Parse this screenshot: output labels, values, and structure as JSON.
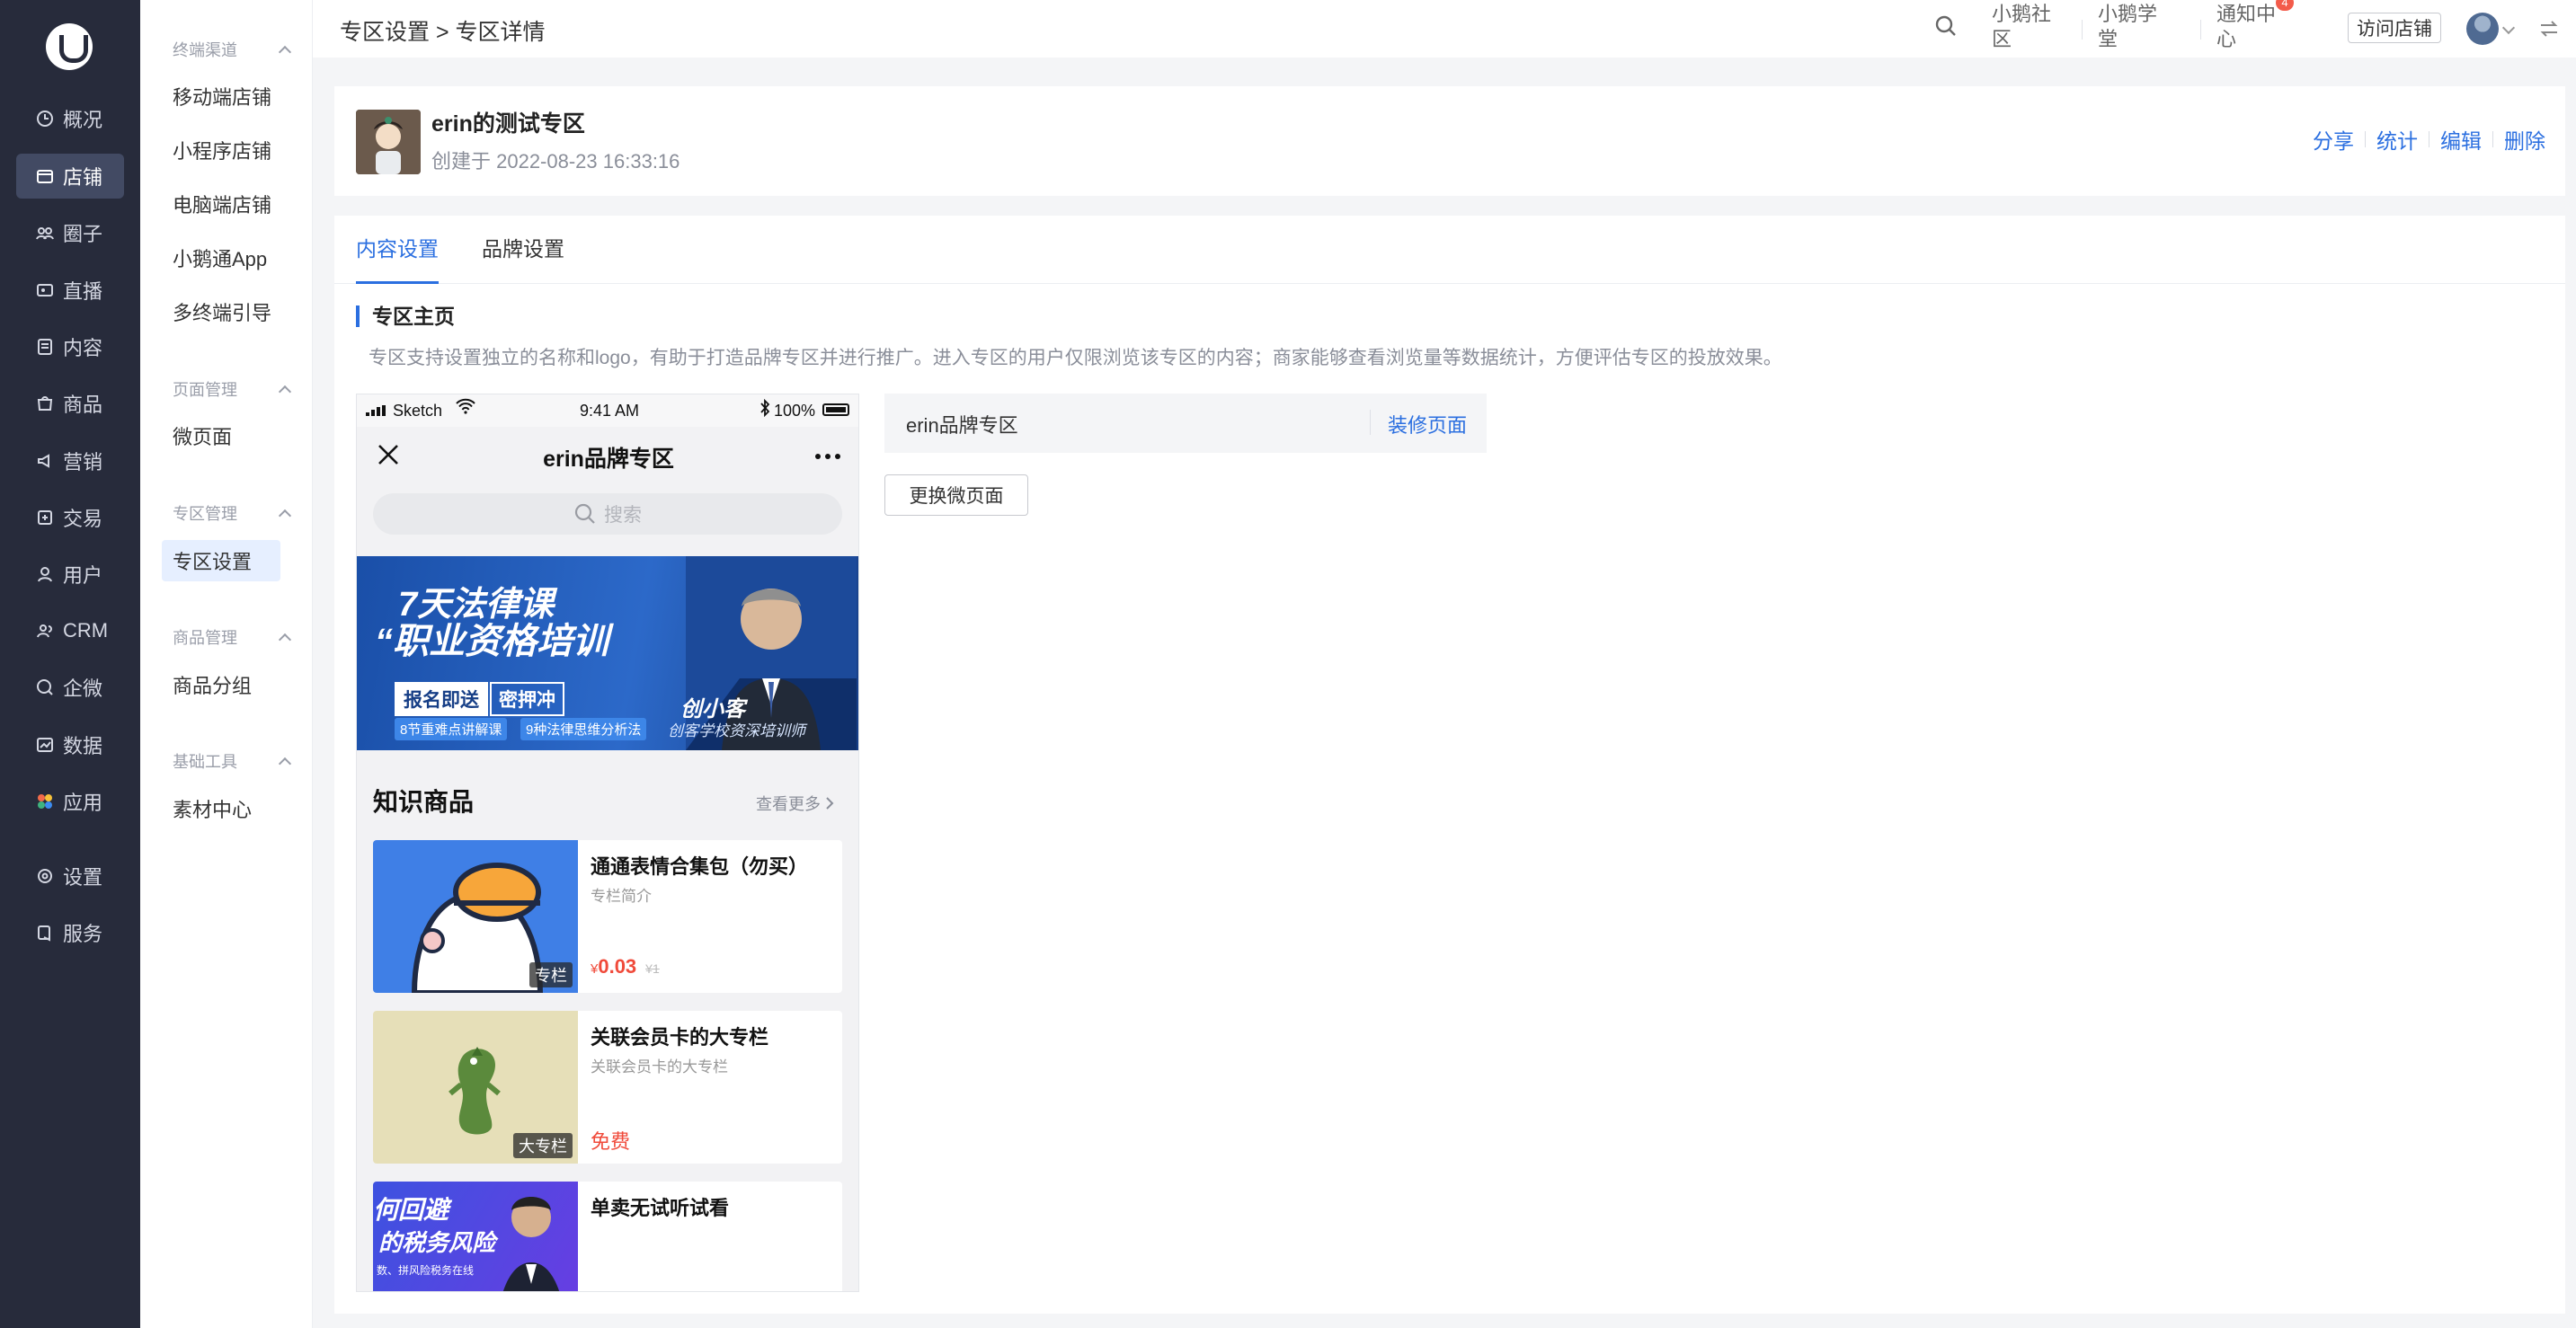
{
  "nav": {
    "items": [
      {
        "label": "概况",
        "icon": "overview-icon"
      },
      {
        "label": "店铺",
        "icon": "shop-icon"
      },
      {
        "label": "圈子",
        "icon": "community-icon"
      },
      {
        "label": "直播",
        "icon": "live-icon"
      },
      {
        "label": "内容",
        "icon": "content-icon"
      },
      {
        "label": "商品",
        "icon": "goods-icon"
      },
      {
        "label": "营销",
        "icon": "marketing-icon"
      },
      {
        "label": "交易",
        "icon": "trade-icon"
      },
      {
        "label": "用户",
        "icon": "user-icon"
      },
      {
        "label": "CRM",
        "icon": "crm-icon"
      },
      {
        "label": "企微",
        "icon": "wecom-icon"
      },
      {
        "label": "数据",
        "icon": "data-icon"
      },
      {
        "label": "应用",
        "icon": "apps-icon"
      },
      {
        "label": "设置",
        "icon": "settings-icon"
      },
      {
        "label": "服务",
        "icon": "service-icon"
      }
    ],
    "active": "店铺"
  },
  "subnav": {
    "groups": [
      {
        "title": "终端渠道",
        "items": [
          "移动端店铺",
          "小程序店铺",
          "电脑端店铺",
          "小鹅通App",
          "多终端引导"
        ]
      },
      {
        "title": "页面管理",
        "items": [
          "微页面"
        ]
      },
      {
        "title": "专区管理",
        "items": [
          "专区设置"
        ]
      },
      {
        "title": "商品管理",
        "items": [
          "商品分组"
        ]
      },
      {
        "title": "基础工具",
        "items": [
          "素材中心"
        ]
      }
    ],
    "active": "专区设置"
  },
  "topbar": {
    "breadcrumb": "专区设置 > 专区详情",
    "links": [
      "小鹅社区",
      "小鹅学堂",
      "通知中心"
    ],
    "notification_count": "4",
    "visit_store": "访问店铺"
  },
  "header": {
    "title": "erin的测试专区",
    "created": "创建于 2022-08-23 16:33:16",
    "actions": [
      "分享",
      "统计",
      "编辑",
      "删除"
    ]
  },
  "tabs": [
    "内容设置",
    "品牌设置"
  ],
  "section": {
    "title": "专区主页",
    "desc": "专区支持设置独立的名称和logo，有助于打造品牌专区并进行推广。进入专区的用户仅限浏览该专区的内容；商家能够查看浏览量等数据统计，方便评估专区的投放效果。"
  },
  "phone": {
    "carrier": "Sketch",
    "time": "9:41 AM",
    "battery": "100%",
    "title": "erin品牌专区",
    "search_placeholder": "搜索",
    "banner": {
      "line1": "7天法律课",
      "line2": "“职业资格培训",
      "tag1": "报名即送",
      "tag2": "密押冲",
      "chip1": "8节重难点讲解课",
      "chip2": "9种法律思维分析法",
      "name": "创小客",
      "name_sub": "创客学校资深培训师"
    },
    "goods_section": "知识商品",
    "see_more": "查看更多",
    "goods": [
      {
        "name": "通通表情合集包（勿买）",
        "desc": "专栏简介",
        "badge": "专栏",
        "price_symbol": "¥",
        "price": "0.03",
        "orig": "¥1"
      },
      {
        "name": "关联会员卡的大专栏",
        "desc": "关联会员卡的大专栏",
        "badge": "大专栏",
        "price": "免费"
      },
      {
        "name": "单卖无试听试看",
        "desc": "",
        "badge": "",
        "price": "",
        "thumb_text1": "何回避",
        "thumb_text2": "的税务风险",
        "thumb_text3": "数、拼风险税务在线"
      }
    ]
  },
  "settings": {
    "page_name": "erin品牌专区",
    "decorate": "装修页面",
    "change_page": "更换微页面"
  },
  "colors": {
    "accent": "#2b6fe0",
    "nav_bg": "#272b3b",
    "nav_active": "#424a63",
    "price": "#f04a3a"
  }
}
